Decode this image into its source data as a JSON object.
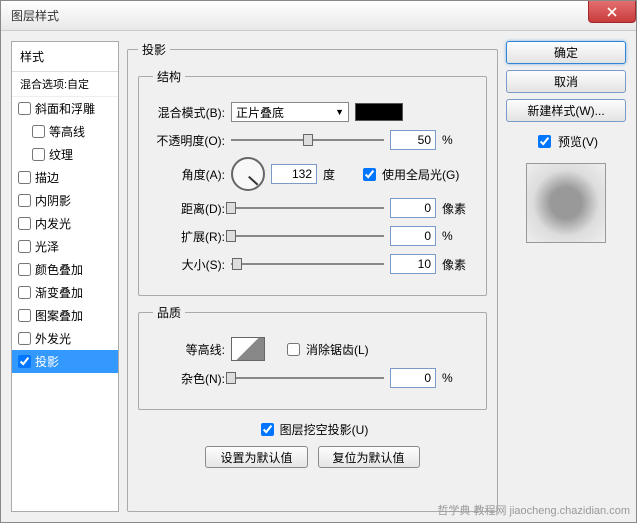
{
  "window": {
    "title": "图层样式"
  },
  "close": "×",
  "styles": {
    "header": "样式",
    "blending": "混合选项:自定",
    "items": [
      {
        "label": "斜面和浮雕",
        "checked": false,
        "indent": false
      },
      {
        "label": "等高线",
        "checked": false,
        "indent": true
      },
      {
        "label": "纹理",
        "checked": false,
        "indent": true
      },
      {
        "label": "描边",
        "checked": false,
        "indent": false
      },
      {
        "label": "内阴影",
        "checked": false,
        "indent": false
      },
      {
        "label": "内发光",
        "checked": false,
        "indent": false
      },
      {
        "label": "光泽",
        "checked": false,
        "indent": false
      },
      {
        "label": "颜色叠加",
        "checked": false,
        "indent": false
      },
      {
        "label": "渐变叠加",
        "checked": false,
        "indent": false
      },
      {
        "label": "图案叠加",
        "checked": false,
        "indent": false
      },
      {
        "label": "外发光",
        "checked": false,
        "indent": false
      },
      {
        "label": "投影",
        "checked": true,
        "indent": false,
        "selected": true
      }
    ]
  },
  "panel": {
    "title": "投影",
    "structure": {
      "legend": "结构",
      "blendMode": {
        "label": "混合模式(B):",
        "value": "正片叠底",
        "color": "#000000"
      },
      "opacity": {
        "label": "不透明度(O):",
        "value": 50,
        "unit": "%",
        "pos": 50
      },
      "angle": {
        "label": "角度(A):",
        "value": 132,
        "unit": "度",
        "global": {
          "label": "使用全局光(G)",
          "checked": true
        }
      },
      "distance": {
        "label": "距离(D):",
        "value": 0,
        "unit": "像素",
        "pos": 0
      },
      "spread": {
        "label": "扩展(R):",
        "value": 0,
        "unit": "%",
        "pos": 0
      },
      "size": {
        "label": "大小(S):",
        "value": 10,
        "unit": "像素",
        "pos": 4
      }
    },
    "quality": {
      "legend": "品质",
      "contour": {
        "label": "等高线:",
        "antialias": {
          "label": "消除锯齿(L)",
          "checked": false
        }
      },
      "noise": {
        "label": "杂色(N):",
        "value": 0,
        "unit": "%",
        "pos": 0
      }
    },
    "knockout": {
      "label": "图层挖空投影(U)",
      "checked": true
    },
    "defaults": {
      "set": "设置为默认值",
      "reset": "复位为默认值"
    }
  },
  "right": {
    "ok": "确定",
    "cancel": "取消",
    "newStyle": "新建样式(W)...",
    "preview": {
      "label": "预览(V)",
      "checked": true
    }
  },
  "watermark": "哲学典 教程网  jiaocheng.chazidian.com"
}
